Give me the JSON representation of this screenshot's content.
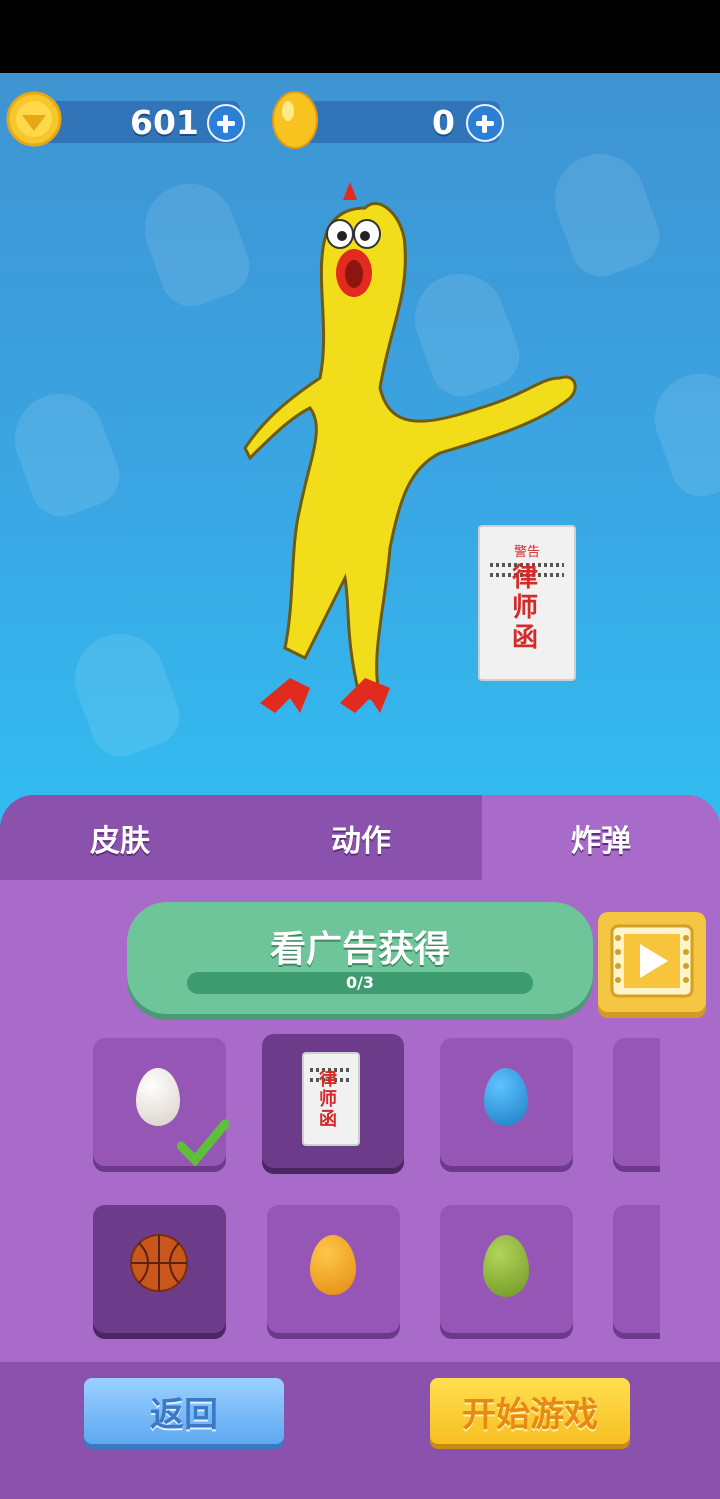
{
  "currency": {
    "coins": "601",
    "eggs": "0"
  },
  "lawyer_letter": {
    "small": "警告",
    "big": [
      "律",
      "师",
      "函"
    ]
  },
  "tabs": [
    {
      "label": "皮肤",
      "active": false
    },
    {
      "label": "动作",
      "active": false
    },
    {
      "label": "炸弹",
      "active": true
    }
  ],
  "ad": {
    "title": "看广告获得",
    "progress_text": "0/3",
    "progress_fraction": 0
  },
  "items": [
    {
      "name": "white-egg",
      "color": "#f2ede6",
      "equipped": true
    },
    {
      "name": "lawyer-letter",
      "selected": true
    },
    {
      "name": "blue-egg",
      "color": "#2e9be0"
    },
    {
      "name": "basketball",
      "color": "#c9561c",
      "selected": true
    },
    {
      "name": "orange-egg",
      "color": "#f5a51c"
    },
    {
      "name": "green-egg",
      "color": "#8db43a"
    }
  ],
  "buttons": {
    "back": "返回",
    "start": "开始游戏"
  },
  "colors": {
    "panel": "#a86bca",
    "tab_bar": "#8a52ad",
    "ad_green": "#6fc59a"
  }
}
